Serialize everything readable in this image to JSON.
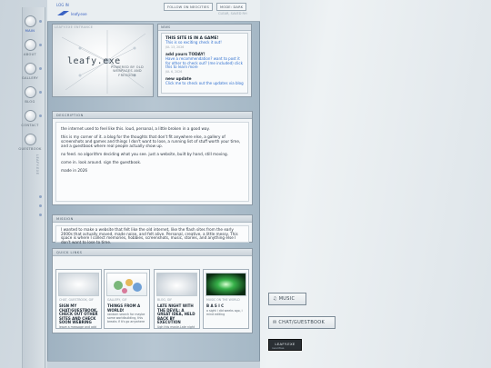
{
  "header": {
    "log_in": "LOG IN",
    "logo_text": "leafy.exe",
    "follow_label": "FOLLOW ON NEOCITIES",
    "mode_label": "MODE: DARK",
    "subtext": "CLEAR, SAVED RH"
  },
  "sidebar": {
    "items": [
      {
        "label": "MAIN",
        "icon": "home-icon"
      },
      {
        "label": "ABOUT",
        "icon": "person-icon"
      },
      {
        "label": "GALLERY",
        "icon": "image-icon"
      },
      {
        "label": "BLOG",
        "icon": "pen-icon"
      },
      {
        "label": "CONTACT",
        "icon": "mail-icon"
      },
      {
        "label": "GUESTBOOK",
        "icon": "book-icon"
      }
    ],
    "rail_text": "LEAFY.EXE"
  },
  "hero": {
    "label": "LEAFY.EXE  ENTRANCE",
    "title": "leafy.exe",
    "subtitle": "POWERED BY OLD WEBPAGES AND FREEDOM"
  },
  "news": {
    "header": "NEWS",
    "items": [
      {
        "title": "THIS SITE IS IN A GAME!",
        "body": "This is so exciting check it out!",
        "date": "JUL 13, 2026"
      },
      {
        "title": "add yours TODAY!",
        "body": "Have a recommendation? want to post it for other to check out? (me included) click this to learn more",
        "date": "JUL 6, 2026"
      },
      {
        "title": "new update",
        "body": "Click me to check out the updates via blog",
        "date": ""
      }
    ]
  },
  "description": {
    "header": "DESCRIPTION",
    "paragraphs": [
      "the internet used to feel like this. loud, personal, a little broken in a good way.",
      "this is my corner of it. a blog for the thoughts that don't fit anywhere else, a gallery of screenshots and games and things I don't want to lose, a running list of stuff worth your time, and a guestbook where real people actually show up.",
      "no feed. no algorithm deciding what you see. just a website, built by hand, still moving.",
      "come in. look around. sign the guestbook.",
      "made in 2026"
    ]
  },
  "mission": {
    "header": "MISSION",
    "text": "I wanted to make a website that felt like the old internet, like the flash sites from the early 2000s that actually moved, made noise, and felt alive. Personal, creative, a little messy. This space is where I collect memories, hobbies, screenshots, music, stories, and anything else I don't want to lose to time."
  },
  "quick_links": {
    "header": "QUICK LINKS",
    "cards": [
      {
        "date": "CHAT, GUESTBOOK, GIF",
        "title": "SIGN MY CHAT/GUESTBOOK, CHECK OUT OTHER SITES AND CHECK SOON WEBRING",
        "desc": "leave a message and add"
      },
      {
        "date": "GALLERY, GIF",
        "title": "THINGS FROM A WORLD!",
        "desc": "random search for maybe some worldbuilding, this breaks if it's go anywhere"
      },
      {
        "date": "BLOG, GIF",
        "title": "LATE NIGHT WITH THE DEVIL: A GREAT IDEA, HELD BACK BY EXECUTION",
        "desc": "Ugh this movie.Late night"
      },
      {
        "date": "MUSIC ON THE WORLD",
        "title": "B A S I C",
        "desc": "a sight i did weeks ago, i mind editing"
      }
    ]
  },
  "right_buttons": {
    "music": "MUSIC",
    "chat": "CHAT/GUESTBOOK"
  },
  "badge": {
    "line1": "LEAFY.EXE",
    "line2": "neocities"
  }
}
